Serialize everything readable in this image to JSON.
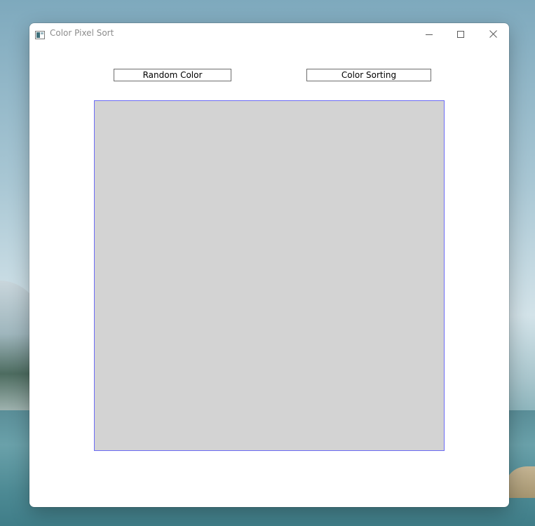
{
  "window": {
    "title": "Color Pixel Sort",
    "icon": "app-window-icon",
    "controls": {
      "minimize_icon": "minimize-icon",
      "maximize_icon": "maximize-icon",
      "close_icon": "close-icon"
    }
  },
  "toolbar": {
    "random_color_label": "Random Color",
    "color_sorting_label": "Color Sorting"
  },
  "canvas": {
    "fill_color": "#d3d3d3",
    "border_color": "#6b6bf5"
  }
}
